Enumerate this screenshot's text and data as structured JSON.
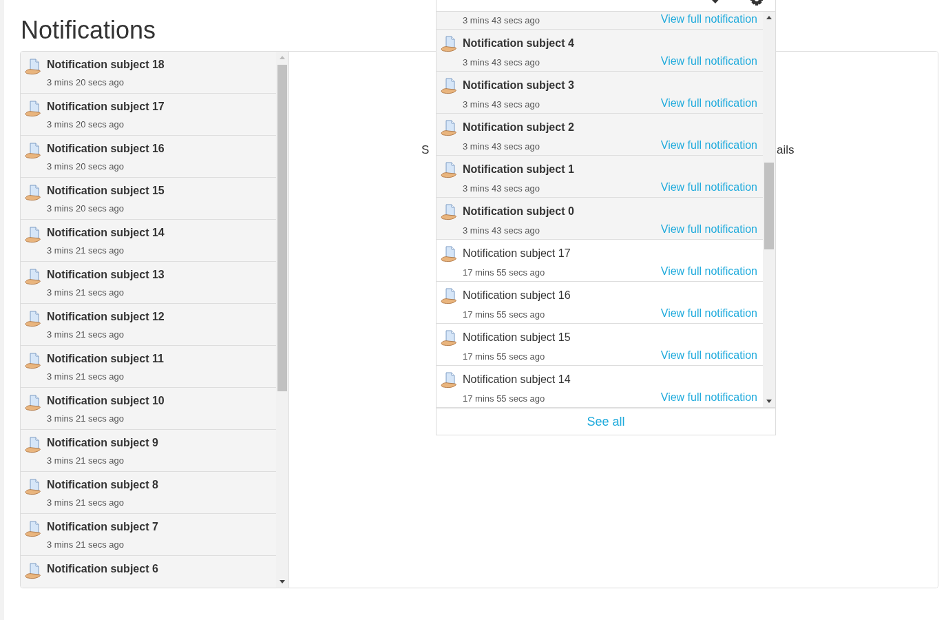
{
  "page": {
    "title": "Notifications"
  },
  "list": [
    {
      "subject": "Notification subject 18",
      "time": "3 mins 20 secs ago",
      "read": false
    },
    {
      "subject": "Notification subject 17",
      "time": "3 mins 20 secs ago",
      "read": false
    },
    {
      "subject": "Notification subject 16",
      "time": "3 mins 20 secs ago",
      "read": false
    },
    {
      "subject": "Notification subject 15",
      "time": "3 mins 20 secs ago",
      "read": false
    },
    {
      "subject": "Notification subject 14",
      "time": "3 mins 21 secs ago",
      "read": false
    },
    {
      "subject": "Notification subject 13",
      "time": "3 mins 21 secs ago",
      "read": false
    },
    {
      "subject": "Notification subject 12",
      "time": "3 mins 21 secs ago",
      "read": false
    },
    {
      "subject": "Notification subject 11",
      "time": "3 mins 21 secs ago",
      "read": false
    },
    {
      "subject": "Notification subject 10",
      "time": "3 mins 21 secs ago",
      "read": false
    },
    {
      "subject": "Notification subject 9",
      "time": "3 mins 21 secs ago",
      "read": false
    },
    {
      "subject": "Notification subject 8",
      "time": "3 mins 21 secs ago",
      "read": false
    },
    {
      "subject": "Notification subject 7",
      "time": "3 mins 21 secs ago",
      "read": false
    },
    {
      "subject": "Notification subject 6",
      "read": false
    }
  ],
  "detail_text": {
    "left": "S",
    "right": "ails"
  },
  "popover": {
    "items": [
      {
        "time": "3 mins 43 secs ago",
        "link": "View full notification"
      },
      {
        "subject": "Notification subject 4",
        "time": "3 mins 43 secs ago",
        "link": "View full notification",
        "read": false
      },
      {
        "subject": "Notification subject 3",
        "time": "3 mins 43 secs ago",
        "link": "View full notification",
        "read": false
      },
      {
        "subject": "Notification subject 2",
        "time": "3 mins 43 secs ago",
        "link": "View full notification",
        "read": false
      },
      {
        "subject": "Notification subject 1",
        "time": "3 mins 43 secs ago",
        "link": "View full notification",
        "read": false
      },
      {
        "subject": "Notification subject 0",
        "time": "3 mins 43 secs ago",
        "link": "View full notification",
        "read": false
      },
      {
        "subject": "Notification subject 17",
        "time": "17 mins 55 secs ago",
        "link": "View full notification",
        "read": true
      },
      {
        "subject": "Notification subject 16",
        "time": "17 mins 55 secs ago",
        "link": "View full notification",
        "read": true
      },
      {
        "subject": "Notification subject 15",
        "time": "17 mins 55 secs ago",
        "link": "View full notification",
        "read": true
      },
      {
        "subject": "Notification subject 14",
        "time": "17 mins 55 secs ago",
        "link": "View full notification",
        "read": true
      }
    ],
    "footer": "See all"
  }
}
